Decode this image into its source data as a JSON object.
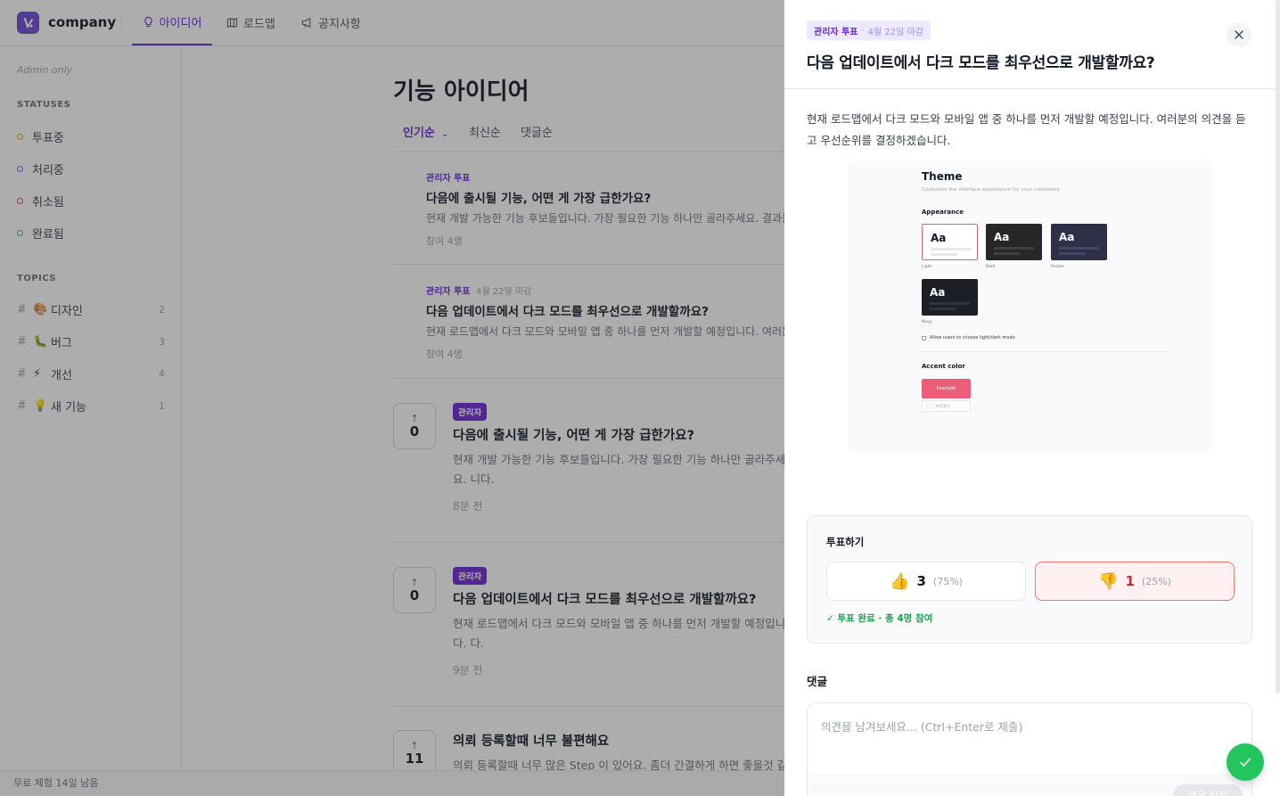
{
  "header": {
    "company": "company",
    "tabs": [
      {
        "label": "아이디어",
        "icon": "lightbulb-icon",
        "active": true
      },
      {
        "label": "로드맵",
        "icon": "map-icon",
        "active": false
      },
      {
        "label": "공지사항",
        "icon": "megaphone-icon",
        "active": false
      }
    ]
  },
  "sidebar": {
    "admin_only": "Admin only",
    "statuses_heading": "STATUSES",
    "statuses": [
      {
        "label": "투표중",
        "color": "#f59e0b"
      },
      {
        "label": "처리중",
        "color": "#3b82f6"
      },
      {
        "label": "취소됨",
        "color": "#ef4444"
      },
      {
        "label": "완료됨",
        "color": "#22c55e"
      }
    ],
    "topics_heading": "TOPICS",
    "topics": [
      {
        "hash": "#",
        "emoji": "🎨",
        "label": "디자인",
        "count": "2"
      },
      {
        "hash": "#",
        "emoji": "🐛",
        "label": "버그",
        "count": "3"
      },
      {
        "hash": "#",
        "emoji": "⚡",
        "label": "개선",
        "count": "4"
      },
      {
        "hash": "#",
        "emoji": "💡",
        "label": "새 기능",
        "count": "1"
      }
    ],
    "trial": "무료 체험 14일 남음"
  },
  "main": {
    "title": "기능 아이디어",
    "sort_tabs": [
      "인기순",
      "최신순",
      "댓글순"
    ],
    "polls": [
      {
        "tag": "관리자 투표",
        "deadline": "",
        "title": "다음에 출시될 기능, 어떤 게 가장 급한가요?",
        "desc": "현재 개발 가능한 기능 후보들입니다. 가장 필요한 기능 하나만 골라주세요. 결과를 바",
        "meta": "참여 4명"
      },
      {
        "tag": "관리자 투표",
        "deadline": "4월 22일 마감",
        "title": "다음 업데이트에서 다크 모드를 최우선으로 개발할까요?",
        "desc": "현재 로드맵에서 다크 모드와 모바일 앱 중 하나를 먼저 개발할 예정입니다. 여러분의",
        "meta": "참여 4명"
      }
    ],
    "posts": [
      {
        "votes": "0",
        "badge": "관리자",
        "title": "다음에 출시될 기능, 어떤 게 가장 급한가요?",
        "desc": "현재 개발 가능한 기능 후보들입니다. 가장 필요한 기능 하나만 골라주세요. 니다.",
        "time": "8분 전"
      },
      {
        "votes": "0",
        "badge": "관리자",
        "title": "다음 업데이트에서 다크 모드를 최우선으로 개발할까요?",
        "desc": "현재 로드맵에서 다크 모드와 모바일 앱 중 하나를 먼저 개발할 예정입니다. 다.",
        "time": "9분 전"
      },
      {
        "votes": "11",
        "badge": "",
        "title": "의뢰 등록할때 너무 불편해요",
        "desc": "의뢰 등록할때 너무 많은 Step 이 있어요. 좀더 간결하게 하면 좋을것 같",
        "time": ""
      }
    ]
  },
  "drawer": {
    "tag": "관리자 투표",
    "separator": "·",
    "deadline": "4월 22일 마감",
    "title": "다음 업데이트에서 다크 모드를 최우선으로 개발할까요?",
    "body": "현재 로드맵에서 다크 모드와 모바일 앱 중 하나를 먼저 개발할 예정입니다. 여러분의 의견을 듣고 우선순위를 결정하겠습니다.",
    "screenshot": {
      "title": "Theme",
      "subtitle": "Customize the interface appearance for your customers.",
      "appearance_heading": "Appearance",
      "aa": "Aa",
      "tiles": [
        {
          "label": "Light",
          "bg": "#ffffff",
          "fg": "#111827"
        },
        {
          "label": "Dark",
          "bg": "#27272a",
          "fg": "#ffffff"
        },
        {
          "label": "Purple",
          "bg": "#2e3047",
          "fg": "#ffffff"
        },
        {
          "label": "Navy",
          "bg": "#1c1f26",
          "fg": "#ffffff"
        }
      ],
      "allow_text": "Allow users to choose light/dark mode",
      "accent_heading": "Accent color",
      "accent_button": "Example",
      "accent_hex": "#ef567c"
    },
    "vote": {
      "title": "투표하기",
      "up": {
        "emoji": "👍",
        "count": "3",
        "pct": "(75%)"
      },
      "down": {
        "emoji": "👎",
        "count": "1",
        "pct": "(25%)"
      },
      "status": "✓ 투표 완료 · 총 4명 참여"
    },
    "comments": {
      "title": "댓글",
      "placeholder": "의견을 남겨보세요... (Ctrl+Enter로 제출)",
      "submit": "댓글 작성"
    }
  },
  "colors": {
    "accent": "#6d28d9",
    "success": "#22c55e",
    "danger": "#ef4444"
  }
}
